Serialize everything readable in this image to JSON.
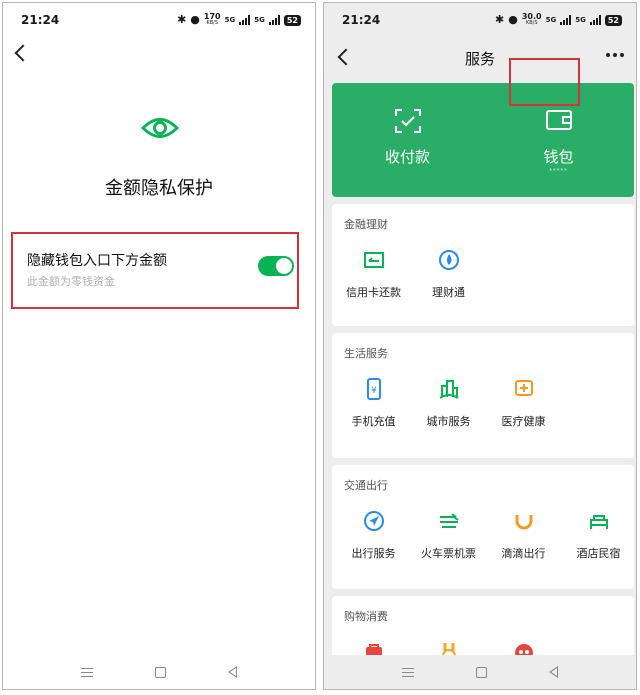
{
  "left": {
    "status": {
      "time": "21:24",
      "speed": "170",
      "speed_unit": "KB/S",
      "net1": "5G",
      "net2": "5G",
      "battery": "52"
    },
    "page_title": "金额隐私保护",
    "setting": {
      "title": "隐藏钱包入口下方金额",
      "subtitle": "此金额为零钱资金",
      "enabled": true
    }
  },
  "right": {
    "status": {
      "time": "21:24",
      "speed": "30.0",
      "speed_unit": "KB/S",
      "net1": "5G",
      "net2": "5G",
      "battery": "52"
    },
    "header_title": "服务",
    "top_card": {
      "pay_label": "收付款",
      "wallet_label": "钱包",
      "wallet_masked": "*****"
    },
    "sections": [
      {
        "title": "金融理财",
        "items": [
          "信用卡还款",
          "理财通"
        ]
      },
      {
        "title": "生活服务",
        "items": [
          "手机充值",
          "城市服务",
          "医疗健康"
        ]
      },
      {
        "title": "交通出行",
        "items": [
          "出行服务",
          "火车票机票",
          "滴滴出行",
          "酒店民宿"
        ]
      },
      {
        "title": "购物消费",
        "items": []
      }
    ]
  },
  "colors": {
    "accent_green": "#07b355",
    "card_green": "#2aae67",
    "highlight_red": "#d9313a",
    "icon_blue": "#2b8be6",
    "icon_orange": "#f59a23"
  }
}
